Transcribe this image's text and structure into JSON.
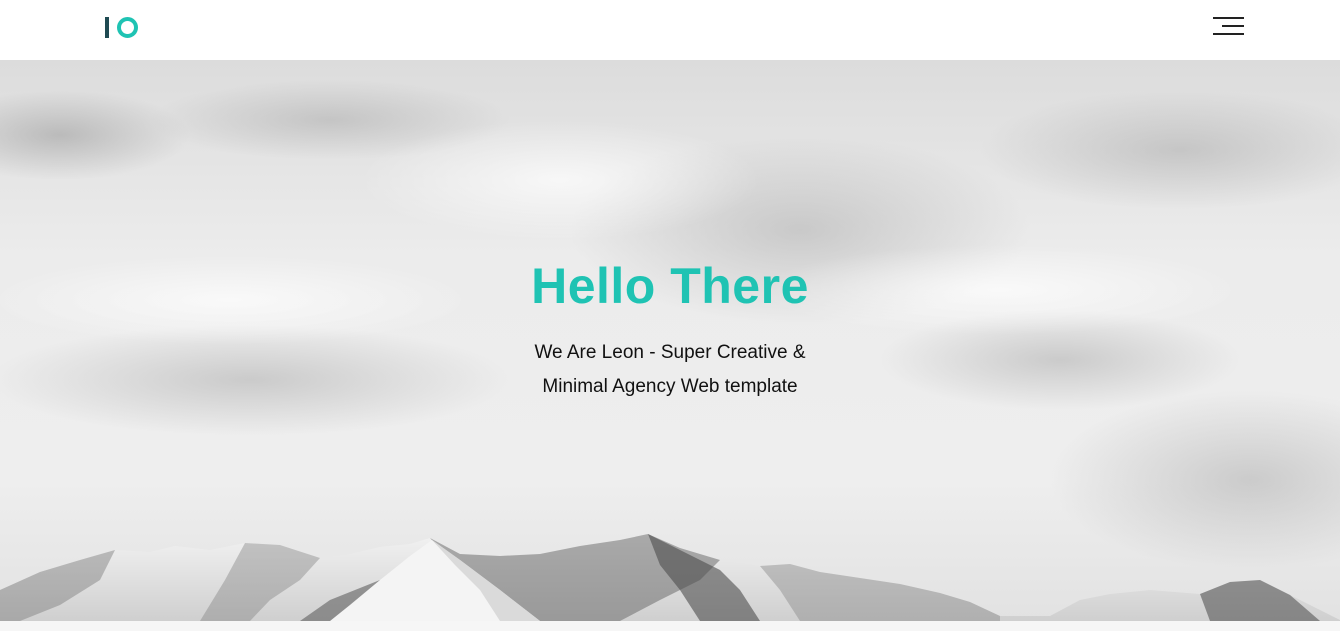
{
  "header": {
    "logo_name": "io-logo",
    "menu_icon": "hamburger-menu-icon"
  },
  "hero": {
    "title": "Hello There",
    "subtitle": "We Are Leon - Super Creative & Minimal Agency Web template",
    "background": "grayscale-sky-mountains"
  },
  "colors": {
    "accent": "#1fc3b3",
    "logo_dark": "#1f4a52",
    "text": "#111111",
    "nav_bg": "#ffffff"
  }
}
